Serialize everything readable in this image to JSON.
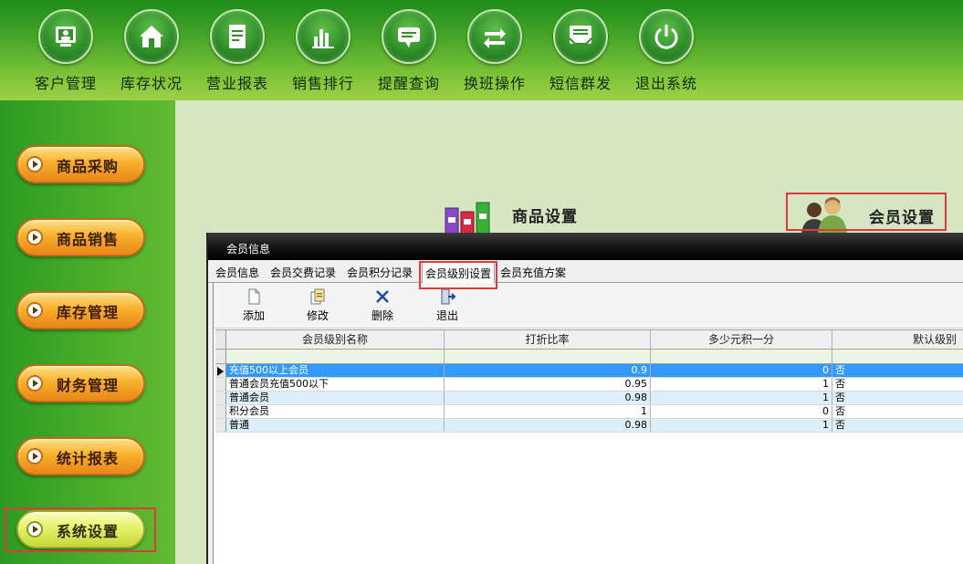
{
  "toolbar": {
    "items": [
      {
        "label": "客户管理",
        "icon": "customer-icon"
      },
      {
        "label": "库存状况",
        "icon": "warehouse-icon"
      },
      {
        "label": "营业报表",
        "icon": "report-icon"
      },
      {
        "label": "销售排行",
        "icon": "bar-chart-icon"
      },
      {
        "label": "提醒查询",
        "icon": "reminder-icon"
      },
      {
        "label": "换班操作",
        "icon": "shift-swap-icon"
      },
      {
        "label": "短信群发",
        "icon": "sms-icon"
      },
      {
        "label": "退出系统",
        "icon": "power-icon"
      }
    ]
  },
  "sidebar": {
    "items": [
      {
        "label": "商品采购"
      },
      {
        "label": "商品销售"
      },
      {
        "label": "库存管理"
      },
      {
        "label": "财务管理"
      },
      {
        "label": "统计报表"
      },
      {
        "label": "系统设置",
        "active": true
      }
    ]
  },
  "shortcuts": {
    "product_settings": "商品设置",
    "member_settings": "会员设置"
  },
  "window": {
    "title": "会员信息",
    "tabs": [
      {
        "label": "会员信息"
      },
      {
        "label": "会员交费记录"
      },
      {
        "label": "会员积分记录"
      },
      {
        "label": "会员级别设置",
        "active": true
      },
      {
        "label": "会员充值方案"
      }
    ],
    "toolbar": {
      "add": "添加",
      "edit": "修改",
      "delete": "删除",
      "exit": "退出"
    },
    "grid": {
      "columns": [
        "会员级别名称",
        "打折比率",
        "多少元积一分",
        "默认级别"
      ],
      "rows": [
        [
          "充值500以上会员",
          "0.9",
          "0",
          "否"
        ],
        [
          "普通会员充值500以下",
          "0.95",
          "1",
          "否"
        ],
        [
          "普通会员",
          "0.98",
          "1",
          "否"
        ],
        [
          "积分会员",
          "1",
          "0",
          "否"
        ],
        [
          "普通",
          "0.98",
          "1",
          "否"
        ]
      ],
      "selected_row": 0
    }
  },
  "colors": {
    "highlight": "#e23a3a",
    "selection": "#3399ff",
    "alt_row": "#dcf0fa"
  }
}
